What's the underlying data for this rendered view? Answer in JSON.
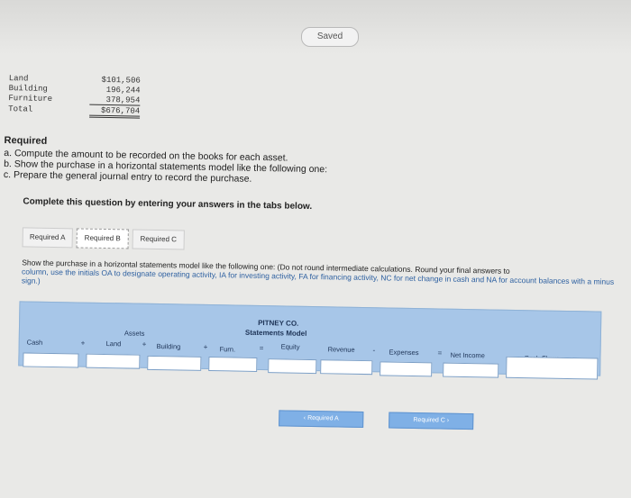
{
  "header": {
    "status_badge": "Saved"
  },
  "ledger": {
    "rows": [
      {
        "label": "Land",
        "value": "$101,506"
      },
      {
        "label": "Building",
        "value": "196,244"
      },
      {
        "label": "Furniture",
        "value": "378,954"
      },
      {
        "label": "Total",
        "value": "$676,704"
      }
    ]
  },
  "required": {
    "title": "Required",
    "items": [
      "a. Compute the amount to be recorded on the books for each asset.",
      "b. Show the purchase in a horizontal statements model like the following one:",
      "c. Prepare the general journal entry to record the purchase."
    ]
  },
  "complete_prompt": "Complete this question by entering your answers in the tabs below.",
  "tabs": [
    {
      "label": "Required A"
    },
    {
      "label": "Required B"
    },
    {
      "label": "Required C"
    }
  ],
  "instructions": {
    "lead": "Show the purchase in a horizontal statements model like the following one: (Do not round intermediate calculations. Round your final answers to",
    "rest": "column, use the initials OA to designate operating activity, IA for investing activity, FA for financing activity, NC for net change in cash and NA for account balances with a minus sign.)"
  },
  "model": {
    "company": "PITNEY CO.",
    "title": "Statements Model",
    "assets_label": "Assets",
    "columns": [
      "Cash",
      "Land",
      "Building",
      "Furn.",
      "Equity",
      "Revenue",
      "Expenses",
      "Net Income",
      "Cash Flows"
    ],
    "operators": [
      "+",
      "+",
      "+",
      "=",
      "-",
      "="
    ]
  },
  "nav": {
    "prev": "Required A",
    "next": "Required C"
  },
  "icons": {
    "prev": "chevron-left-icon",
    "next": "chevron-right-icon"
  }
}
